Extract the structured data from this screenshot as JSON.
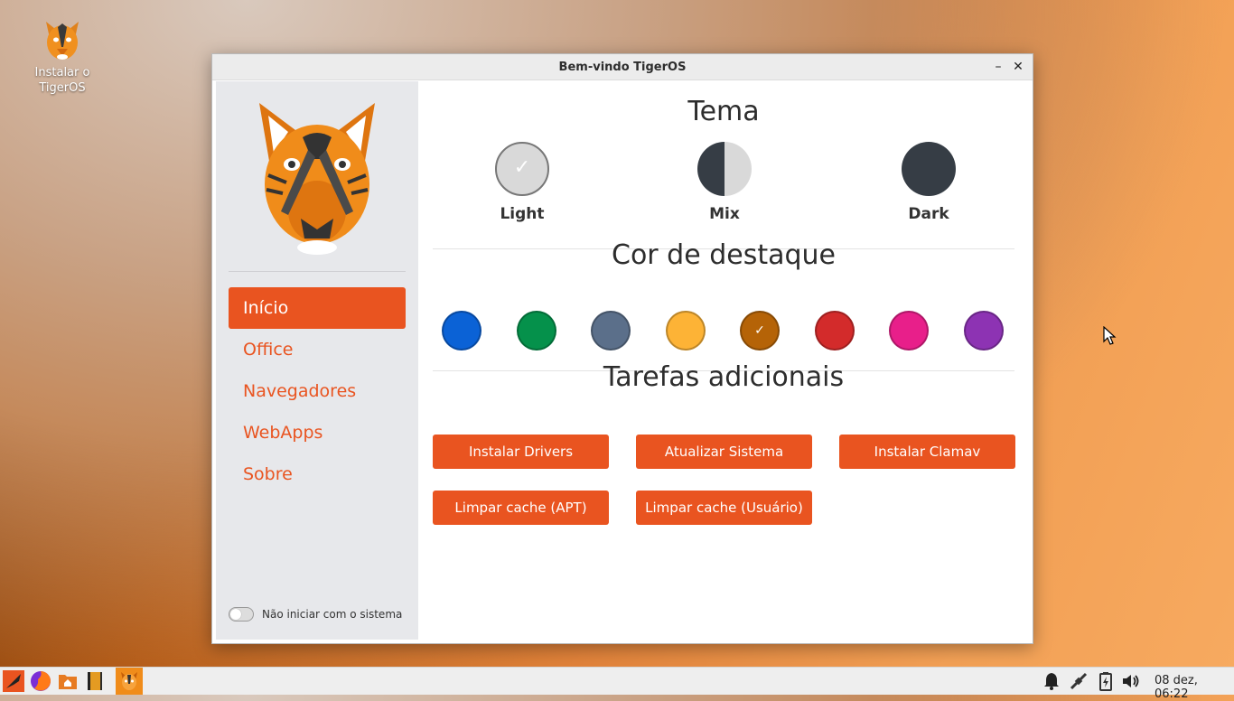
{
  "desktop": {
    "icon_label": "Instalar o TigerOS"
  },
  "window": {
    "title": "Bem-vindo TigerOS",
    "minimize": "–",
    "close": "✕"
  },
  "sidebar": {
    "items": [
      {
        "label": "Início"
      },
      {
        "label": "Office"
      },
      {
        "label": "Navegadores"
      },
      {
        "label": "WebApps"
      },
      {
        "label": "Sobre"
      }
    ],
    "active_index": 0,
    "autostart_label": "Não iniciar com o sistema"
  },
  "theme": {
    "heading": "Tema",
    "options": [
      {
        "label": "Light",
        "selected": true
      },
      {
        "label": "Mix",
        "selected": false
      },
      {
        "label": "Dark",
        "selected": false
      }
    ]
  },
  "accent": {
    "heading": "Cor de destaque",
    "colors": [
      "#0b62d6",
      "#05914b",
      "#5b6f8a",
      "#fdb336",
      "#b56307",
      "#d32b2b",
      "#e81f8a",
      "#8d33b3"
    ],
    "selected_index": 4
  },
  "tasks": {
    "heading": "Tarefas adicionais",
    "buttons": [
      "Instalar Drivers",
      "Atualizar Sistema",
      "Instalar Clamav",
      "Limpar cache (APT)",
      "Limpar cache (Usuário)"
    ]
  },
  "taskbar": {
    "apps": [
      "launcher-icon",
      "firefox-icon",
      "files-icon",
      "text-editor-icon",
      "tigeros-welcome-icon"
    ],
    "tray": [
      "bell-icon",
      "network-icon",
      "battery-icon",
      "volume-icon"
    ],
    "clock": "08 dez, 06:22"
  },
  "colors": {
    "accent": "#e95420",
    "dark_theme": "#363d45"
  }
}
